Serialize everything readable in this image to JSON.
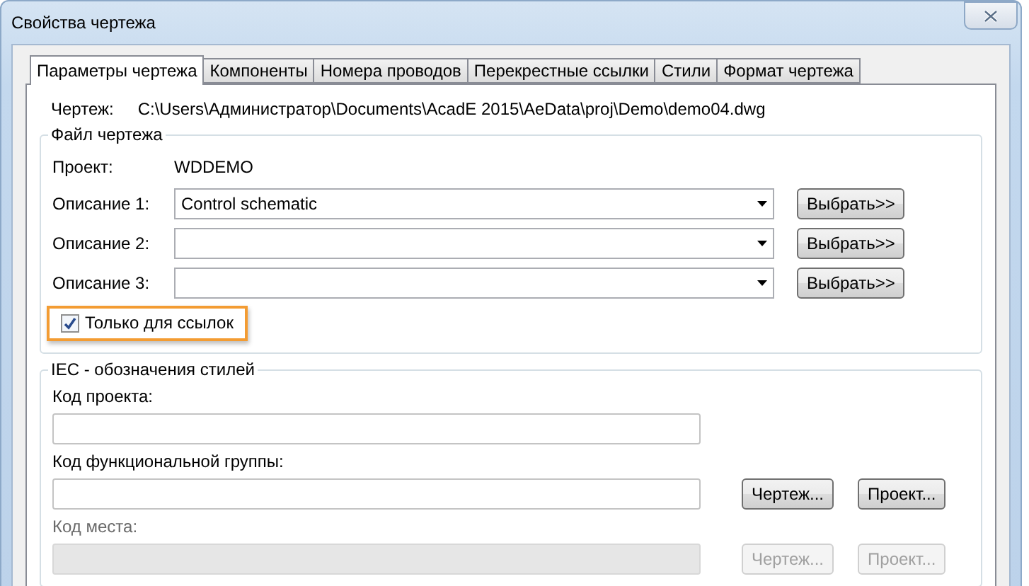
{
  "window": {
    "title": "Свойства чертежа"
  },
  "tabs": [
    {
      "label": "Параметры чертежа",
      "selected": true
    },
    {
      "label": "Компоненты",
      "selected": false
    },
    {
      "label": "Номера проводов",
      "selected": false
    },
    {
      "label": "Перекрестные ссылки",
      "selected": false
    },
    {
      "label": "Стили",
      "selected": false
    },
    {
      "label": "Формат чертежа",
      "selected": false
    }
  ],
  "drawing": {
    "label": "Чертеж:",
    "path": "C:\\Users\\Администратор\\Documents\\AcadE 2015\\AeData\\proj\\Demo\\demo04.dwg"
  },
  "file_group": {
    "title": "Файл чертежа",
    "project_label": "Проект:",
    "project_value": "WDDEMO",
    "descriptions": [
      {
        "label": "Описание 1:",
        "value": "Control schematic",
        "button": "Выбрать>>"
      },
      {
        "label": "Описание 2:",
        "button": "Выбрать>>"
      },
      {
        "label": "Описание 3:",
        "button": "Выбрать>>"
      }
    ],
    "reference_only": {
      "label": "Только для ссылок",
      "checked": true,
      "highlighted": true
    }
  },
  "iec_group": {
    "title": "IEC - обозначения стилей",
    "fields": [
      {
        "label": "Код проекта:",
        "disabled": false
      },
      {
        "label": "Код функциональной группы:",
        "disabled": false,
        "buttons": [
          "Чертеж...",
          "Проект..."
        ]
      },
      {
        "label": "Код места:",
        "disabled": true,
        "buttons": [
          "Чертеж...",
          "Проект..."
        ]
      }
    ]
  }
}
